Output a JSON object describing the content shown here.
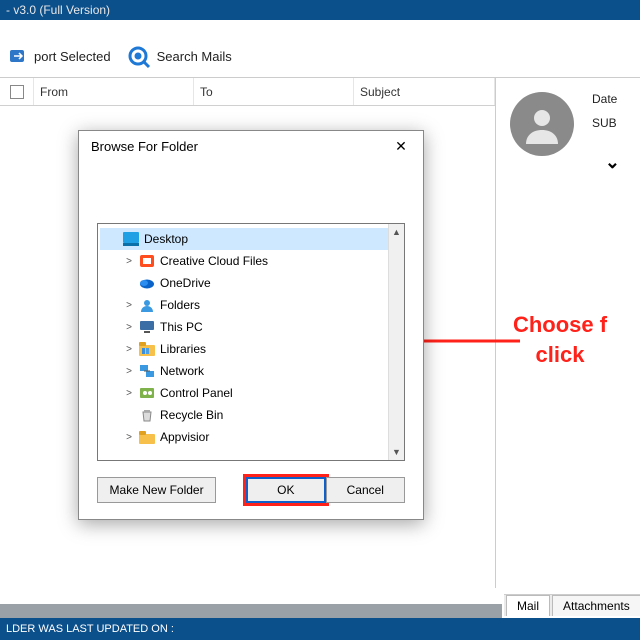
{
  "title_suffix": "- v3.0 (Full Version)",
  "toolbar": {
    "export_selected": "port Selected",
    "search_mails": "Search Mails"
  },
  "grid_headers": {
    "from": "From",
    "to": "To",
    "subject": "Subject"
  },
  "preview": {
    "date_label": "Date",
    "subject_label": "SUB"
  },
  "annotation": {
    "line1": "Choose f",
    "line2": "click "
  },
  "tabs": {
    "mail": "Mail",
    "attachments": "Attachments"
  },
  "status": "LDER WAS LAST UPDATED ON :",
  "dialog": {
    "title": "Browse For Folder",
    "nodes": [
      {
        "label": "Desktop",
        "level": 0,
        "selected": true,
        "icon": "desktop",
        "expander": ""
      },
      {
        "label": "Creative Cloud Files",
        "level": 1,
        "icon": "ccloud",
        "expander": ">"
      },
      {
        "label": "OneDrive",
        "level": 1,
        "icon": "onedrive",
        "expander": ""
      },
      {
        "label": "Folders",
        "level": 1,
        "icon": "user",
        "expander": ">"
      },
      {
        "label": "This PC",
        "level": 1,
        "icon": "pc",
        "expander": ">"
      },
      {
        "label": "Libraries",
        "level": 1,
        "icon": "libraries",
        "expander": ">"
      },
      {
        "label": "Network",
        "level": 1,
        "icon": "network",
        "expander": ">"
      },
      {
        "label": "Control Panel",
        "level": 1,
        "icon": "cpanel",
        "expander": ">"
      },
      {
        "label": "Recycle Bin",
        "level": 1,
        "icon": "recycle",
        "expander": ""
      },
      {
        "label": "Appvisior",
        "level": 1,
        "icon": "folder",
        "expander": ">"
      }
    ],
    "buttons": {
      "make_new": "Make New Folder",
      "ok": "OK",
      "cancel": "Cancel"
    }
  }
}
